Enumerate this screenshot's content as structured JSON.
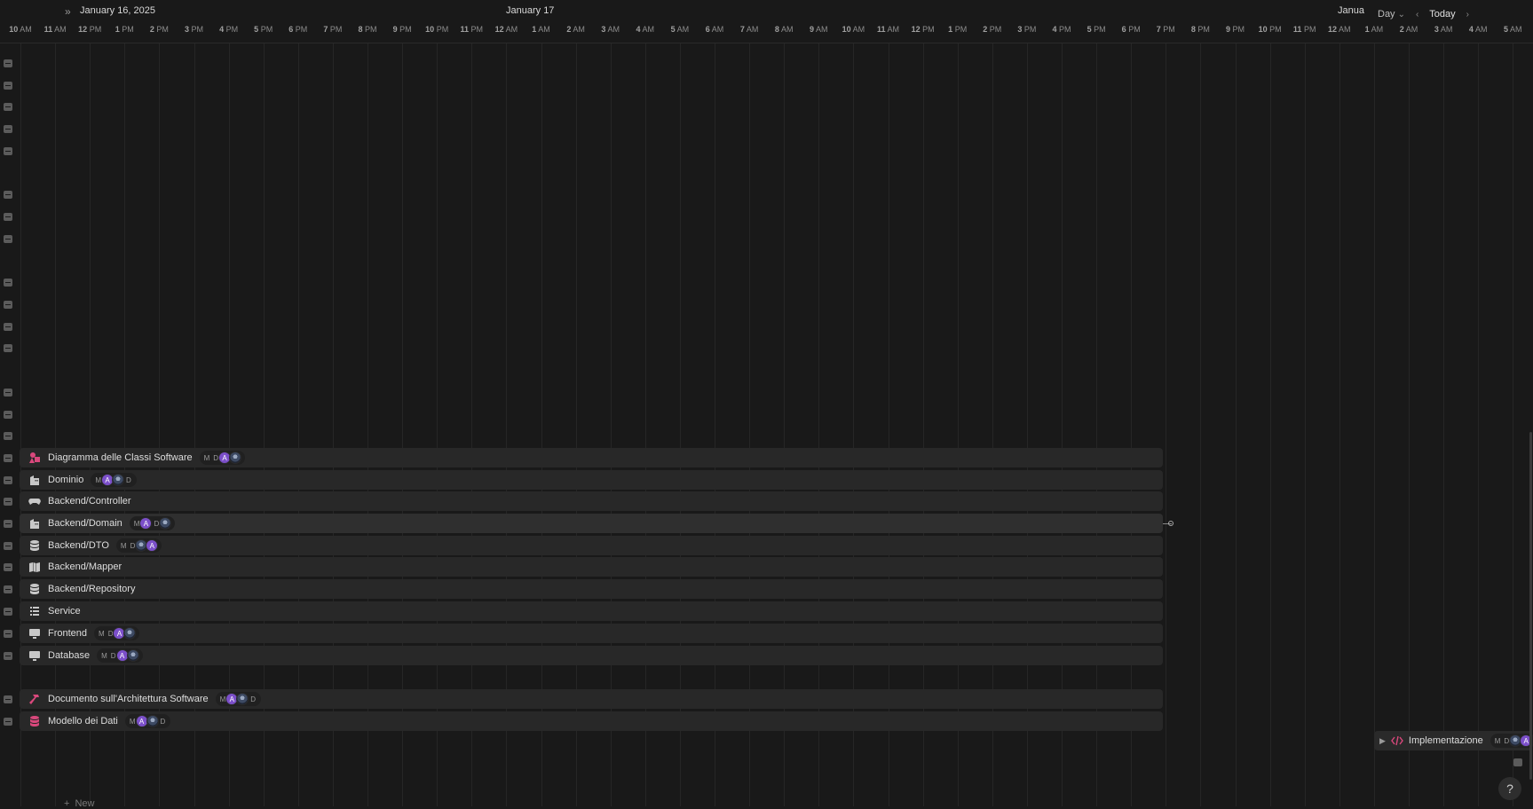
{
  "header": {
    "date_left": "January 16, 2025",
    "date_mid": "January 17",
    "date_right": "Janua",
    "view_label": "Day",
    "today_label": "Today"
  },
  "hours": [
    [
      "10",
      "AM"
    ],
    [
      "11",
      "AM"
    ],
    [
      "12",
      "PM"
    ],
    [
      "1",
      "PM"
    ],
    [
      "2",
      "PM"
    ],
    [
      "3",
      "PM"
    ],
    [
      "4",
      "PM"
    ],
    [
      "5",
      "PM"
    ],
    [
      "6",
      "PM"
    ],
    [
      "7",
      "PM"
    ],
    [
      "8",
      "PM"
    ],
    [
      "9",
      "PM"
    ],
    [
      "10",
      "PM"
    ],
    [
      "11",
      "PM"
    ],
    [
      "12",
      "AM"
    ],
    [
      "1",
      "AM"
    ],
    [
      "2",
      "AM"
    ],
    [
      "3",
      "AM"
    ],
    [
      "4",
      "AM"
    ],
    [
      "5",
      "AM"
    ],
    [
      "6",
      "AM"
    ],
    [
      "7",
      "AM"
    ],
    [
      "8",
      "AM"
    ],
    [
      "9",
      "AM"
    ],
    [
      "10",
      "AM"
    ],
    [
      "11",
      "AM"
    ],
    [
      "12",
      "PM"
    ],
    [
      "1",
      "PM"
    ],
    [
      "2",
      "PM"
    ],
    [
      "3",
      "PM"
    ],
    [
      "4",
      "PM"
    ],
    [
      "5",
      "PM"
    ],
    [
      "6",
      "PM"
    ],
    [
      "7",
      "PM"
    ],
    [
      "8",
      "PM"
    ],
    [
      "9",
      "PM"
    ],
    [
      "10",
      "PM"
    ],
    [
      "11",
      "PM"
    ],
    [
      "12",
      "AM"
    ],
    [
      "1",
      "AM"
    ],
    [
      "2",
      "AM"
    ],
    [
      "3",
      "AM"
    ],
    [
      "4",
      "AM"
    ],
    [
      "5",
      "AM"
    ]
  ],
  "tasks": [
    {
      "label": "Diagramma delle Classi Software",
      "icon": "shapes-icon",
      "color": "#d9487c",
      "people": [
        "M",
        "D",
        "A",
        "photo"
      ]
    },
    {
      "label": "Dominio",
      "icon": "building-icon",
      "color": "#c8c8c8",
      "people": [
        "M",
        "A",
        "photo",
        "D"
      ]
    },
    {
      "label": "Backend/Controller",
      "icon": "gamepad-icon",
      "color": "#c8c8c8",
      "people": []
    },
    {
      "label": "Backend/Domain",
      "icon": "building-icon",
      "color": "#c8c8c8",
      "people": [
        "M",
        "A",
        "D",
        "photo"
      ],
      "active": true
    },
    {
      "label": "Backend/DTO",
      "icon": "database-icon",
      "color": "#c8c8c8",
      "people": [
        "M",
        "D",
        "photo",
        "A"
      ]
    },
    {
      "label": "Backend/Mapper",
      "icon": "map-icon",
      "color": "#c8c8c8",
      "people": []
    },
    {
      "label": "Backend/Repository",
      "icon": "database-icon",
      "color": "#c8c8c8",
      "people": []
    },
    {
      "label": "Service",
      "icon": "list-icon",
      "color": "#c8c8c8",
      "people": []
    },
    {
      "label": "Frontend",
      "icon": "monitor-icon",
      "color": "#c8c8c8",
      "people": [
        "M",
        "D",
        "A",
        "photo"
      ]
    },
    {
      "label": "Database",
      "icon": "monitor-icon",
      "color": "#c8c8c8",
      "people": [
        "M",
        "D",
        "A",
        "photo"
      ]
    },
    {
      "label": "Documento sull'Architettura Software",
      "icon": "hammer-icon",
      "color": "#d9487c",
      "people": [
        "M",
        "A",
        "photo",
        "D"
      ]
    },
    {
      "label": "Modello dei Dati",
      "icon": "database-icon",
      "color": "#d9487c",
      "people": [
        "M",
        "A",
        "photo",
        "D"
      ]
    }
  ],
  "side_task": {
    "label": "Implementazione",
    "icon": "code-icon",
    "color": "#d9487c",
    "people": [
      "M",
      "D",
      "photo",
      "A"
    ]
  },
  "new_label": "New",
  "help_label": "?"
}
